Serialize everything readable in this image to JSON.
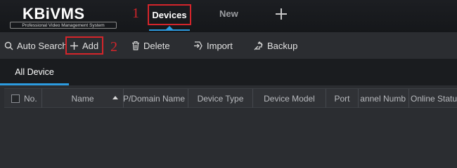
{
  "logo": {
    "brand_kb": "KB",
    "brand_rest": "iVMS",
    "tagline": "Professional Video Management System"
  },
  "annotations": {
    "step1": "1",
    "step2": "2"
  },
  "top_tabs": {
    "devices": "Devices",
    "new": "New",
    "add_tab_icon": "plus-icon"
  },
  "toolbar": {
    "auto_search": "Auto Search",
    "add": "Add",
    "delete": "Delete",
    "import": "Import",
    "backup": "Backup"
  },
  "subtabs": {
    "all_device": "All Device"
  },
  "table": {
    "columns": [
      "No.",
      "Name",
      "P/Domain Name",
      "Device Type",
      "Device Model",
      "Port",
      "annel Numb",
      "Online Status"
    ],
    "rows": []
  },
  "colors": {
    "accent": "#2c9be0",
    "highlight_box": "#d4252b"
  }
}
